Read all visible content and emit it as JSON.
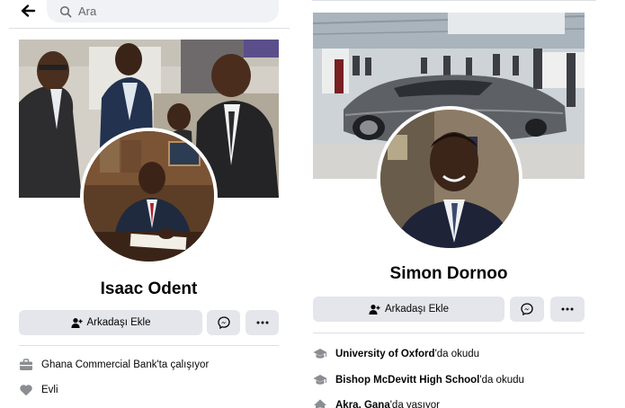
{
  "search": {
    "placeholder": "Ara"
  },
  "profiles": [
    {
      "name": "Isaac Odent",
      "add_friend_label": "Arkadaşı Ekle",
      "info": [
        {
          "icon": "briefcase-icon",
          "bold": "",
          "text": "Ghana Commercial Bank'ta çalışıyor"
        },
        {
          "icon": "heart-icon",
          "bold": "",
          "text": "Evli"
        }
      ]
    },
    {
      "name": "Simon Dornoo",
      "add_friend_label": "Arkadaşı Ekle",
      "info": [
        {
          "icon": "graduation-cap-icon",
          "bold": "University of Oxford",
          "text": "'da okudu"
        },
        {
          "icon": "graduation-cap-icon",
          "bold": "Bishop McDevitt High School",
          "text": "'da okudu"
        },
        {
          "icon": "home-icon",
          "bold": "Akra, Gana",
          "text": "'da yaşıyor"
        }
      ]
    }
  ],
  "colors": {
    "button_bg": "#e4e6eb",
    "search_bg": "#f0f2f5",
    "icon_gray": "#65676b",
    "text": "#050505"
  }
}
